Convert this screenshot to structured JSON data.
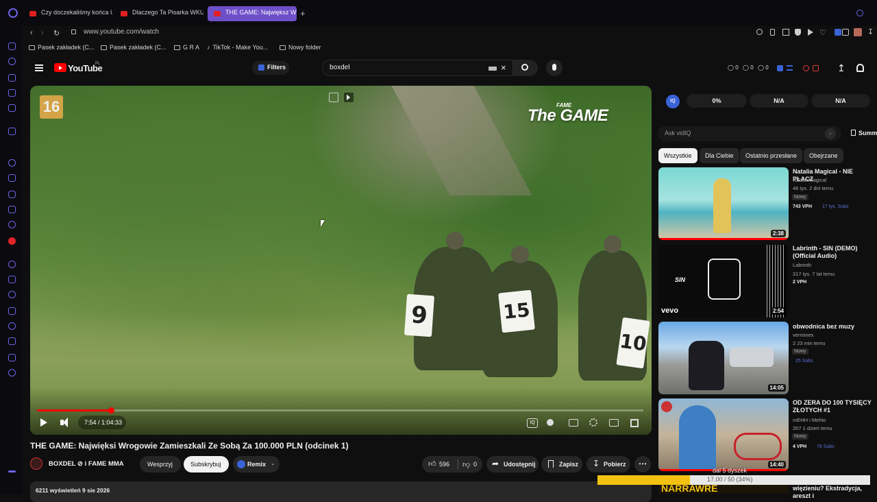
{
  "browser": {
    "tabs": [
      {
        "label": "Czy doczekaliśmy końca U"
      },
      {
        "label": "Dlaczego Ta Pisarka WKUR"
      },
      {
        "label": "THE GAME: Największ Wro"
      }
    ],
    "new_tab": "+",
    "url": "www.youtube.com/watch",
    "bookmarks": [
      "Pasek zakładek (C...",
      "Pasek zakładek (C...",
      "G R A",
      "TikTok - Make You...",
      "Nowy folder"
    ]
  },
  "header": {
    "logo_text": "YouTube",
    "logo_region": "PL",
    "filters_label": "Filters",
    "search_value": "boxdel",
    "ext_counts": [
      "0",
      "0",
      "0"
    ]
  },
  "player": {
    "channel_logo_text": "The GAME",
    "channel_logo_small": "FAME",
    "age_rating": "16",
    "bib_numbers": [
      "9",
      "15",
      "10"
    ],
    "time": "7:54 / 1:04:33",
    "progress": 0.122
  },
  "video": {
    "title": "THE GAME: Najwięksi Wrogowie Zamieszkali Ze Sobą Za 100.000 PLN (odcinek 1)",
    "channel": "BOXDEL ⊘ i FAME MMA",
    "support_label": "Wesprzyj",
    "subscribe_label": "Subskrybuj",
    "remix_label": "Remix",
    "likes": "596",
    "dislikes": "0",
    "share_label": "Udostępnij",
    "save_label": "Zapisz",
    "download_label": "Pobierz",
    "views_line": "6211 wyświetleń  9 sie 2026"
  },
  "vidiq": {
    "stats": [
      "0%",
      "N/A",
      "N/A"
    ],
    "ask_placeholder": "Ask vidIQ",
    "summary_label": "Summ"
  },
  "chips": [
    "Wszystkie",
    "Dla Ciebie",
    "Ostatnio przesłane",
    "Obejrzane"
  ],
  "recommendations": [
    {
      "title": "Natalia Magical - NIE PŁACZ",
      "channel": "NataliaMagical",
      "meta": "46 tys.  2 dni temu",
      "badge": "Nowy",
      "vph": "743 VPH",
      "subs": "17 tys. Subs",
      "duration": "2:38"
    },
    {
      "title": "Labrinth - SIN (DEMO) (Official Audio)",
      "channel": "Labrinth",
      "meta": "317 tys.  7 lat temu",
      "badge": "",
      "vph": "2 VPH",
      "subs": "",
      "duration": "2:54",
      "thumb_text": "SIN",
      "thumb_brand": "vevo"
    },
    {
      "title": "obwodnica bez muzy",
      "channel": "verminex",
      "meta": "2  23 min temu",
      "badge": "Nowy",
      "vph": "",
      "subs": "25 Subs",
      "duration": "14:05"
    },
    {
      "title": "OD ZERA DO 100 TYSIĘCY ZŁOTYCH #1",
      "channel": "mEHH i Mehio",
      "meta": "207  1 dzień temu",
      "badge": "Nowy",
      "vph": "4 VPH",
      "subs": "78 Subs",
      "duration": "14:40"
    }
  ],
  "partial_rec": {
    "title": "więzieniu? Ekstradycja, areszt i",
    "thumb_text": "NARRAWRE"
  },
  "download_overlay": {
    "line1": "dal 5 dyszek",
    "line2": "17.00 / 50 (34%)",
    "progress": 0.34
  },
  "colors": {
    "accent": "#6d4fc8",
    "yt_red": "#ff0000",
    "vidiq_blue": "#3a63d8",
    "subs_blue": "#5b6fd8",
    "overlay_yellow": "#f3c211"
  }
}
